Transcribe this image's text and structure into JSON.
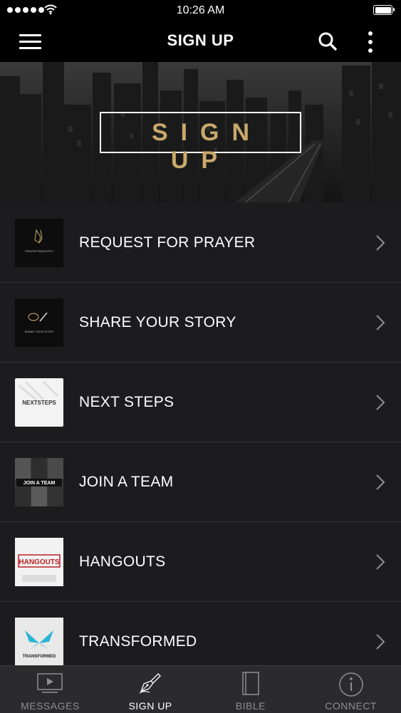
{
  "status_bar": {
    "time": "10:26 AM"
  },
  "nav": {
    "title": "SIGN UP"
  },
  "hero": {
    "title": "SIGN UP",
    "title_color": "#c9a96a"
  },
  "items": [
    {
      "label": "REQUEST FOR PRAYER",
      "thumb_text": "PRAYER REQUESTS",
      "icon": "praying-hands-icon"
    },
    {
      "label": "SHARE YOUR STORY",
      "thumb_text": "SHARE YOUR STORY",
      "icon": "speech-bubble-pen-icon"
    },
    {
      "label": "NEXT STEPS",
      "thumb_text": "NEXTSTEPS"
    },
    {
      "label": "JOIN A TEAM",
      "thumb_text": "JOIN A TEAM"
    },
    {
      "label": "HANGOUTS",
      "thumb_text": "HANGOUTS"
    },
    {
      "label": "TRANSFORMED",
      "thumb_text": "TRANSFORMED",
      "icon": "butterfly-icon"
    }
  ],
  "tabs": [
    {
      "label": "MESSAGES",
      "icon": "video-play-icon",
      "active": false
    },
    {
      "label": "SIGN UP",
      "icon": "pen-nib-icon",
      "active": true
    },
    {
      "label": "BIBLE",
      "icon": "book-icon",
      "active": false
    },
    {
      "label": "CONNECT",
      "icon": "info-circle-icon",
      "active": false
    }
  ],
  "colors": {
    "background": "#1c1c1e",
    "accent_gold": "#c9a96a",
    "tab_inactive": "#8e8e93",
    "divider": "#333333"
  }
}
